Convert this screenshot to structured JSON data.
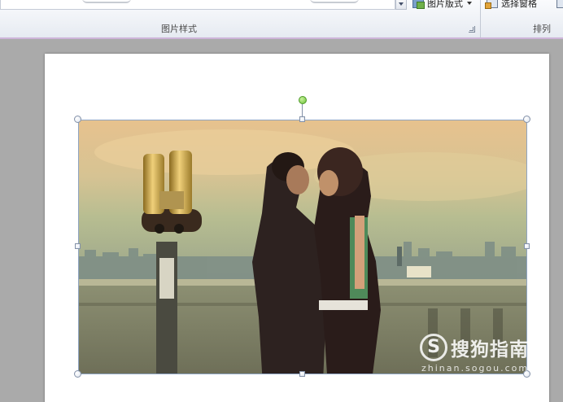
{
  "ribbon": {
    "commands": {
      "picture_layout": "图片版式",
      "selection_pane": "选择窗格"
    },
    "groups": {
      "picture_styles": "图片样式",
      "arrange": "排列"
    },
    "icons": {
      "gallery_more": "dropdown-arrow-icon",
      "picture_layout": "picture-layout-icon",
      "selection_pane": "selection-pane-icon",
      "dialog_launcher": "dialog-launcher-icon",
      "rotate": "rotate-handle-icon"
    },
    "colors": {
      "accent_bar": "#cdb4d8",
      "rotate_handle": "#6cc13a"
    }
  },
  "slide": {
    "image_description": "Couple kissing on a terrace next to coin-operated binoculars overlooking a city skyline, warm vintage tone",
    "selected": true
  },
  "watermark": {
    "logo": "S",
    "text": "搜狗指南",
    "url": "zhinan.sogou.com"
  }
}
